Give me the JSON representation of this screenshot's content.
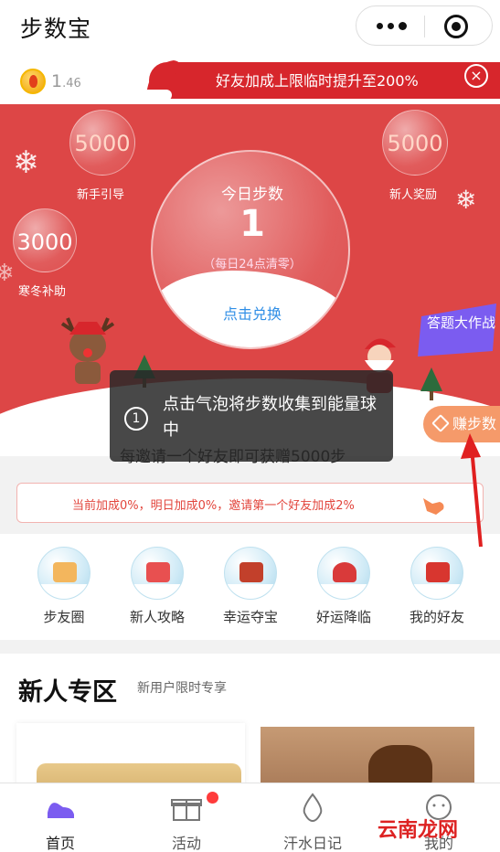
{
  "app": {
    "title": "步数宝"
  },
  "coins": {
    "value": "1",
    "decimal": ".46"
  },
  "promo": {
    "text": "好友加成上限临时提升至200%",
    "close": "×"
  },
  "bubbles": [
    {
      "value": "5000",
      "label": "新手引导"
    },
    {
      "value": "5000",
      "label": "新人奖励"
    },
    {
      "value": "3000",
      "label": "寒冬补助"
    }
  ],
  "today": {
    "title": "今日步数",
    "steps": "1",
    "reset_note": "（每日24点清零）",
    "exchange": "点击兑换"
  },
  "earn_button": "赚步数",
  "toast": {
    "number": "1",
    "text": "点击气泡将步数收集到能量球中"
  },
  "invite_text": "每邀请一个好友即可获赠5000步",
  "bonus_text": "当前加成0%，明日加成0%，邀请第一个好友加成2%",
  "features": [
    {
      "label": "步友圈"
    },
    {
      "label": "新人攻略"
    },
    {
      "label": "幸运夺宝"
    },
    {
      "label": "好运降临"
    },
    {
      "label": "我的好友"
    }
  ],
  "section": {
    "title": "新人专区",
    "subtitle": "新用户限时专享"
  },
  "tabs": [
    {
      "label": "首页"
    },
    {
      "label": "活动"
    },
    {
      "label": "汗水日记"
    },
    {
      "label": "我的"
    }
  ],
  "badge_text": "答题大作战",
  "watermark": "云南龙网",
  "colors": {
    "hero_red": "#dd4646",
    "accent_orange": "#f59a6a",
    "brand_purple": "#7b5cf0"
  }
}
